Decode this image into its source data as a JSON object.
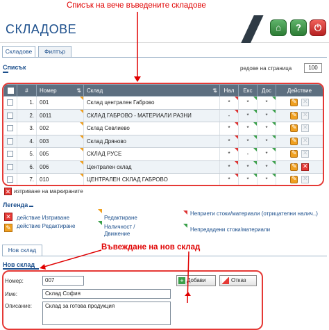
{
  "annotations": {
    "top": "Списък на вече въведените складове",
    "new_store": "Въвеждане на нов склад"
  },
  "header": {
    "title": "СКЛАДОВЕ",
    "buttons": [
      {
        "name": "home-icon",
        "glyph": "⌂"
      },
      {
        "name": "help-icon",
        "glyph": "?"
      },
      {
        "name": "power-icon",
        "glyph": "⏻"
      }
    ]
  },
  "tabs": {
    "stores": "Складове",
    "filter": "Филтър"
  },
  "list_section": {
    "title": "Списък",
    "per_page_label": "редове на страница",
    "per_page_value": "100"
  },
  "table": {
    "headers": {
      "num": "#",
      "code": "Номер",
      "store": "Склад",
      "nal": "Нал",
      "exc": "Екс",
      "dos": "Дос",
      "action": "Действие"
    },
    "rows": [
      {
        "idx": "1.",
        "code": "001",
        "name": "Склад централен Габрово",
        "nal": "*",
        "exc": "*",
        "dos": "*",
        "del_active": false
      },
      {
        "idx": "2.",
        "code": "0011",
        "name": "СКЛАД ГАБРОВО - МАТЕРИАЛИ РАЗНИ",
        "nal": "-",
        "exc": "*",
        "dos": "*",
        "del_active": false
      },
      {
        "idx": "3.",
        "code": "002",
        "name": "Склад Севлиево",
        "nal": "*",
        "exc": "*",
        "dos": "*",
        "del_active": false
      },
      {
        "idx": "4.",
        "code": "003",
        "name": "Склад Дряново",
        "nal": "*",
        "exc": "*",
        "dos": "*",
        "del_active": false
      },
      {
        "idx": "5.",
        "code": "005",
        "name": "СКЛАД РУСЕ",
        "nal": "*",
        "exc": "-",
        "dos": "*",
        "del_active": false
      },
      {
        "idx": "6.",
        "code": "006",
        "name": "Централен склад",
        "nal": "*",
        "exc": "*",
        "dos": "*",
        "del_active": true
      },
      {
        "idx": "7.",
        "code": "010",
        "name": "ЦЕНТРАЛЕН СКЛАД ГАБРОВО",
        "nal": "*",
        "exc": "*",
        "dos": "*",
        "del_active": false
      }
    ],
    "delete_marked": "изтриване на маркираните"
  },
  "legend": {
    "title": "Легенда",
    "items": {
      "delete": "действие Изтриване",
      "edit": "действие Редактиране",
      "editing": "Редактиране",
      "availability": "Наличност / Движение",
      "unaccepted": "Неприети стоки/материали (отрицателни налич..)",
      "unfinished": "Непредадени стоки/материали"
    }
  },
  "new_store": {
    "tab": "Нов склад",
    "title": "Нов склад",
    "number_label": "Номер:",
    "number_value": "007",
    "name_label": "Име:",
    "name_value": "Склад София",
    "desc_label": "Описание:",
    "desc_value": "Склад за готова продукция",
    "add_button": "Добави",
    "cancel_button": "Отказ"
  },
  "colors": {
    "accent": "#1c4f8c",
    "annotation": "#e00000",
    "header_row": "#5d6f80",
    "edit_orange": "#f0a020",
    "delete_red": "#e53935"
  }
}
